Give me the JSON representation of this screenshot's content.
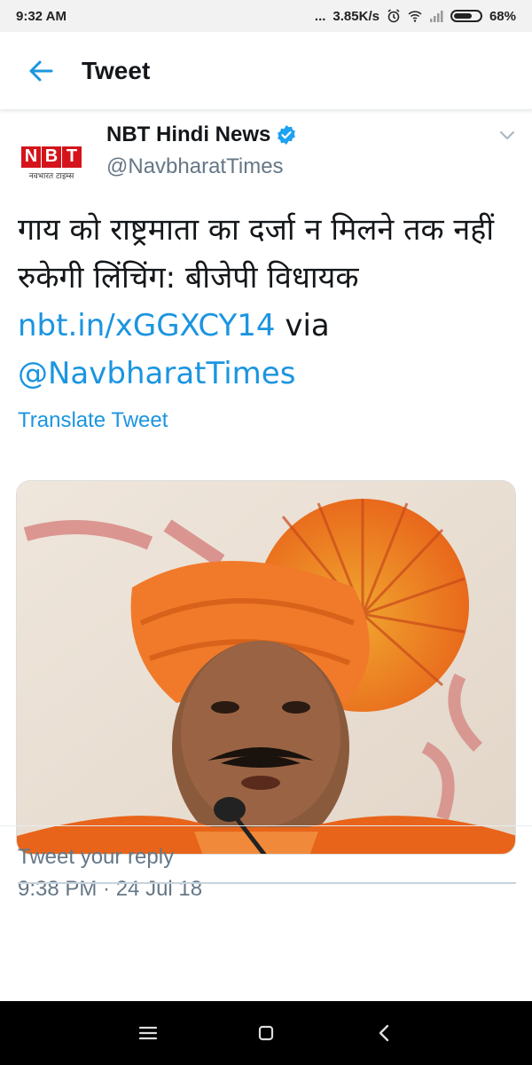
{
  "status_bar": {
    "time": "9:32 AM",
    "network_speed": "3.85K/s",
    "battery": "68%",
    "dots": "..."
  },
  "app_bar": {
    "back_icon": "arrow-left-icon",
    "title": "Tweet"
  },
  "tweet": {
    "author": {
      "name": "NBT Hindi News",
      "handle": "@NavbharatTimes",
      "verified": true,
      "logo_letters": [
        "N",
        "B",
        "T"
      ],
      "logo_subtitle": "नवभारत टाइम्स"
    },
    "text_main": "गाय को राष्ट्रमाता का दर्जा न मिलने तक नहीं रुकेगी लिंचिंग: बीजेपी विधायक ",
    "text_link": "nbt.in/xGGXCY14",
    "text_via": " via ",
    "text_mention": "@NavbharatTimes",
    "translate_label": "Translate Tweet",
    "timestamp": "9:38 PM · 24 Jul 18"
  },
  "reply": {
    "placeholder": "Tweet your reply"
  },
  "colors": {
    "link": "#1b95e0",
    "muted": "#657786",
    "nbt_red": "#d4131a"
  }
}
